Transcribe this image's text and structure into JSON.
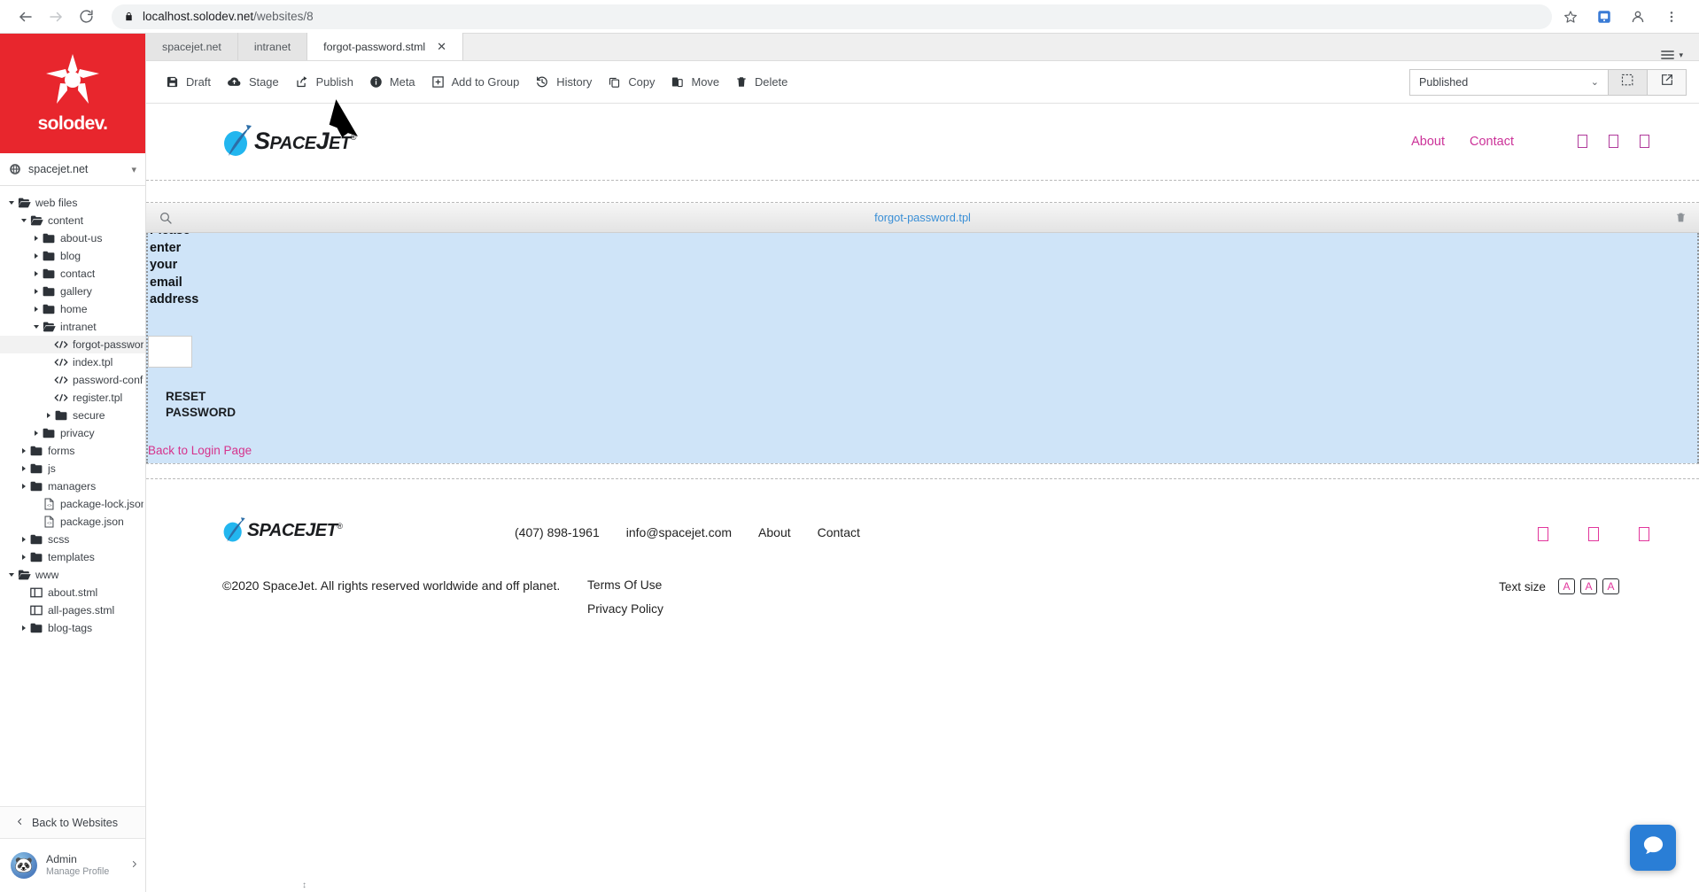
{
  "browser": {
    "back_icon": "back-arrow-icon",
    "forward_icon": "forward-arrow-icon",
    "reload_icon": "reload-icon",
    "lock_icon": "lock-icon",
    "url_host": "localhost.solodev.net",
    "url_path": "/websites/8",
    "star_icon": "bookmark-star-icon",
    "extension_icon": "extension-icon",
    "profile_icon": "profile-avatar-icon",
    "menu_icon": "browser-menu-icon"
  },
  "sidebar": {
    "brand": "solodev.",
    "brand_color": "#e8262d",
    "site_selector": {
      "icon": "globe-icon",
      "label": "spacejet.net",
      "caret": "chevron-down-icon"
    },
    "tree": [
      {
        "label": "web files",
        "depth": 0,
        "type": "folder-open",
        "expanded": true,
        "selected": false
      },
      {
        "label": "content",
        "depth": 1,
        "type": "folder-open",
        "expanded": true,
        "selected": false
      },
      {
        "label": "about-us",
        "depth": 2,
        "type": "folder",
        "expanded": false,
        "selected": false
      },
      {
        "label": "blog",
        "depth": 2,
        "type": "folder",
        "expanded": false,
        "selected": false
      },
      {
        "label": "contact",
        "depth": 2,
        "type": "folder",
        "expanded": false,
        "selected": false
      },
      {
        "label": "gallery",
        "depth": 2,
        "type": "folder",
        "expanded": false,
        "selected": false
      },
      {
        "label": "home",
        "depth": 2,
        "type": "folder",
        "expanded": false,
        "selected": false
      },
      {
        "label": "intranet",
        "depth": 2,
        "type": "folder-open",
        "expanded": true,
        "selected": false
      },
      {
        "label": "forgot-password.tpl",
        "depth": 3,
        "type": "code",
        "expanded": null,
        "selected": true
      },
      {
        "label": "index.tpl",
        "depth": 3,
        "type": "code",
        "expanded": null,
        "selected": false
      },
      {
        "label": "password-confirm.tpl",
        "depth": 3,
        "type": "code",
        "expanded": null,
        "selected": false
      },
      {
        "label": "register.tpl",
        "depth": 3,
        "type": "code",
        "expanded": null,
        "selected": false
      },
      {
        "label": "secure",
        "depth": 3,
        "type": "folder",
        "expanded": false,
        "selected": false
      },
      {
        "label": "privacy",
        "depth": 2,
        "type": "folder",
        "expanded": false,
        "selected": false
      },
      {
        "label": "forms",
        "depth": 1,
        "type": "folder",
        "expanded": false,
        "selected": false
      },
      {
        "label": "js",
        "depth": 1,
        "type": "folder",
        "expanded": false,
        "selected": false
      },
      {
        "label": "managers",
        "depth": 1,
        "type": "folder",
        "expanded": false,
        "selected": false
      },
      {
        "label": "package-lock.json",
        "depth": 2,
        "type": "json",
        "expanded": null,
        "selected": false
      },
      {
        "label": "package.json",
        "depth": 2,
        "type": "json",
        "expanded": null,
        "selected": false
      },
      {
        "label": "scss",
        "depth": 1,
        "type": "folder",
        "expanded": false,
        "selected": false
      },
      {
        "label": "templates",
        "depth": 1,
        "type": "folder",
        "expanded": false,
        "selected": false
      },
      {
        "label": "www",
        "depth": 0,
        "type": "folder-open",
        "expanded": true,
        "selected": false
      },
      {
        "label": "about.stml",
        "depth": 1,
        "type": "page",
        "expanded": null,
        "selected": false
      },
      {
        "label": "all-pages.stml",
        "depth": 1,
        "type": "page",
        "expanded": null,
        "selected": false
      },
      {
        "label": "blog-tags",
        "depth": 1,
        "type": "folder",
        "expanded": false,
        "selected": false
      }
    ],
    "back_to_websites": "Back to Websites",
    "back_icon": "chevron-left-icon",
    "profile": {
      "name": "Admin",
      "subtitle": "Manage Profile",
      "avatar_icon": "panda-avatar-icon",
      "caret": "chevron-right-icon"
    }
  },
  "tabs": [
    {
      "label": "spacejet.net",
      "active": false,
      "closable": false
    },
    {
      "label": "intranet",
      "active": false,
      "closable": false
    },
    {
      "label": "forgot-password.stml",
      "active": true,
      "closable": true
    }
  ],
  "toolbar": {
    "items": [
      {
        "label": "Draft",
        "icon": "save-disk-icon"
      },
      {
        "label": "Stage",
        "icon": "cloud-upload-icon"
      },
      {
        "label": "Publish",
        "icon": "share-export-icon"
      },
      {
        "label": "Meta",
        "icon": "info-circle-icon"
      },
      {
        "label": "Add to Group",
        "icon": "add-box-icon"
      },
      {
        "label": "History",
        "icon": "history-undo-icon"
      },
      {
        "label": "Copy",
        "icon": "copy-icon"
      },
      {
        "label": "Move",
        "icon": "move-clipboard-icon"
      },
      {
        "label": "Delete",
        "icon": "trash-icon"
      }
    ],
    "status_value": "Published",
    "status_caret": "chevron-down-icon",
    "select_region_icon": "select-region-icon",
    "open-external_icon": "open-external-icon"
  },
  "preview": {
    "site_header": {
      "logo_text_a": "S",
      "logo_text_b": "PACE",
      "logo_text_c": "J",
      "logo_text_d": "ET",
      "logo_reg": "®",
      "nav": [
        {
          "label": "About"
        },
        {
          "label": "Contact"
        }
      ],
      "social": [
        "facebook-icon",
        "twitter-icon",
        "linkedin-icon"
      ],
      "nav_color": "#cc3399"
    },
    "component_bar": {
      "search_icon": "search-icon",
      "name": "forgot-password.tpl",
      "delete_icon": "trash-icon",
      "name_color": "#3a8fd6"
    },
    "forgot_password": {
      "intro": "Please enter your email address",
      "email_value": "",
      "submit_label": "RESET PASSWORD",
      "back_link": "Back to Login Page",
      "background": "#cfe4f8"
    },
    "footer": {
      "logo_reg": "®",
      "phone": "(407) 898-1961",
      "email": "info@spacejet.com",
      "nav": [
        {
          "label": "About"
        },
        {
          "label": "Contact"
        }
      ],
      "social": [
        "facebook-icon",
        "twitter-icon",
        "linkedin-icon"
      ],
      "copyright": "©2020 SpaceJet. All rights reserved worldwide and off planet.",
      "links": [
        {
          "label": "Terms Of Use"
        },
        {
          "label": "Privacy Policy"
        }
      ],
      "text_size_label": "Text size",
      "text_size_buttons": [
        "A",
        "A",
        "A"
      ],
      "accent": "#e2369c"
    },
    "chat_icon": "chat-bubble-icon",
    "chat_color": "#2a7ed6"
  }
}
